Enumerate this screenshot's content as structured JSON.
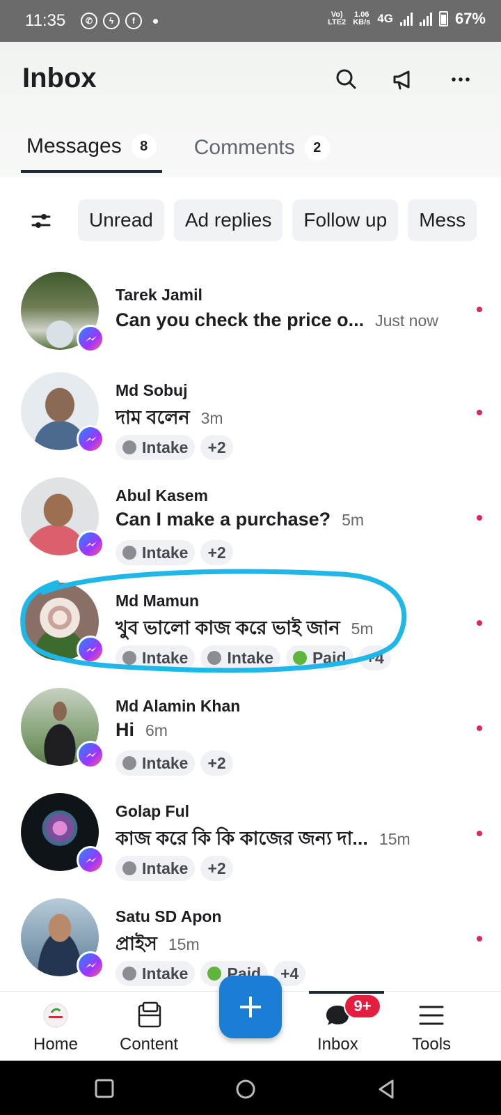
{
  "status_bar": {
    "time": "11:35",
    "volte": "Vo)",
    "lte": "LTE2",
    "speed_value": "1.06",
    "speed_unit": "KB/s",
    "network": "4G",
    "battery": "67%"
  },
  "header": {
    "title": "Inbox",
    "tabs": [
      {
        "label": "Messages",
        "count": "8",
        "active": true
      },
      {
        "label": "Comments",
        "count": "2",
        "active": false
      }
    ]
  },
  "filters": [
    "Unread",
    "Ad replies",
    "Follow up",
    "Mess"
  ],
  "conversations": [
    {
      "name": "Tarek Jamil",
      "message": "Can you check the price o...",
      "time": "Just now",
      "tags": []
    },
    {
      "name": "Md Sobuj",
      "message": "দাম বলেন",
      "time": "3m",
      "tags": [
        {
          "label": "Intake",
          "color": "#8a8d91"
        },
        {
          "label": "+2"
        }
      ]
    },
    {
      "name": "Abul Kasem",
      "message": "Can I make a purchase?",
      "time": "5m",
      "tags": [
        {
          "label": "Intake",
          "color": "#8a8d91"
        },
        {
          "label": "+2"
        }
      ]
    },
    {
      "name": "Md Mamun",
      "message": "খুব ভালো কাজ করে ভাই জান",
      "time": "5m",
      "tags": [
        {
          "label": "Intake",
          "color": "#8a8d91"
        },
        {
          "label": "Intake",
          "color": "#8a8d91"
        },
        {
          "label": "Paid",
          "color": "#5fb43b"
        },
        {
          "label": "+4"
        }
      ]
    },
    {
      "name": "Md Alamin Khan",
      "message": "Hi",
      "time": "6m",
      "tags": [
        {
          "label": "Intake",
          "color": "#8a8d91"
        },
        {
          "label": "+2"
        }
      ]
    },
    {
      "name": "Golap Ful",
      "message": "কাজ করে কি কি কাজের জন্য দা...",
      "time": "15m",
      "tags": [
        {
          "label": "Intake",
          "color": "#8a8d91"
        },
        {
          "label": "+2"
        }
      ]
    },
    {
      "name": "Satu SD Apon",
      "message": "প্রাইস",
      "time": "15m",
      "tags": [
        {
          "label": "Intake",
          "color": "#8a8d91"
        },
        {
          "label": "Paid",
          "color": "#5fb43b"
        },
        {
          "label": "+4"
        }
      ]
    }
  ],
  "bottom_nav": {
    "items": [
      {
        "label": "Home",
        "icon": "home-logo-icon"
      },
      {
        "label": "Content",
        "icon": "content-icon"
      },
      {
        "label": "Inbox",
        "icon": "inbox-chat-icon",
        "badge": "9+"
      },
      {
        "label": "Tools",
        "icon": "menu-icon"
      }
    ],
    "fab_icon": "plus-icon"
  },
  "colors": {
    "accent": "#1a7fd4",
    "unread_dot": "#e0245e",
    "badge": "#e41e3f",
    "highlight": "#1fb6e8"
  }
}
